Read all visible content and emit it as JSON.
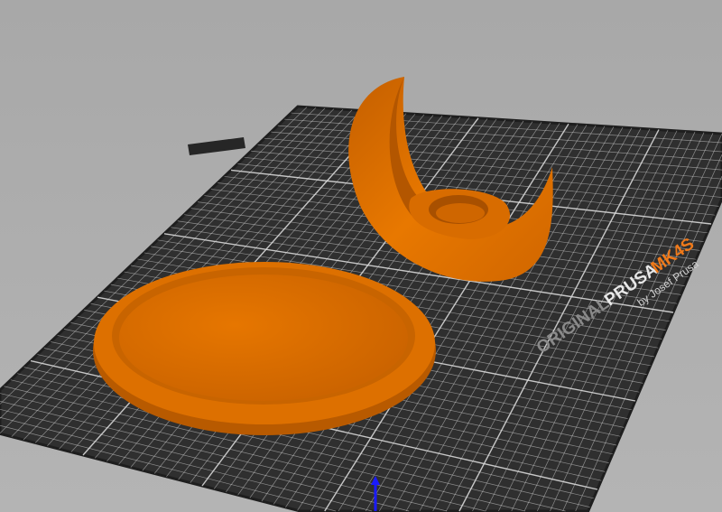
{
  "bed": {
    "brand_prefix": "ORIGINAL",
    "brand_name": "PRUSA",
    "model": "MK4S",
    "byline": "by Josef Prusa",
    "grid_divisions": 25
  },
  "colors": {
    "background": "#adadad",
    "bed": "#2e2e2e",
    "grid": "#d8d8d8",
    "model": "#e07000",
    "model_shade": "#b85800",
    "axis_z": "#1a1aff",
    "accent": "#f07a1a"
  },
  "objects": [
    {
      "name": "round-tray"
    },
    {
      "name": "crescent-moon-candle-holder"
    }
  ]
}
